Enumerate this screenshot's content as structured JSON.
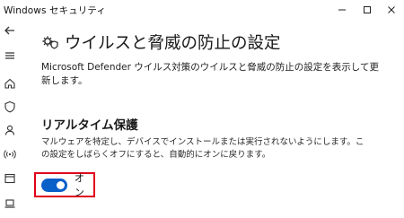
{
  "window": {
    "title": "Windows セキュリティ"
  },
  "rail": {
    "items": [
      "back",
      "menu",
      "home",
      "shield",
      "person",
      "wifi",
      "app-browser",
      "device"
    ]
  },
  "header": {
    "title": "ウイルスと脅威の防止の設定",
    "icon": "gear-shield-icon"
  },
  "description": "Microsoft Defender ウイルス対策のウイルスと脅威の防止の設定を表示して更新します。",
  "realtime": {
    "title": "リアルタイム保護",
    "description": "マルウェアを特定し、デバイスでインストールまたは実行されないようにします。この設定をしばらくオフにすると、自動的にオンに戻ります。",
    "toggle_state": "on",
    "toggle_label": "オン"
  },
  "colors": {
    "accent": "#0a5fc8",
    "highlight": "#e1001a"
  }
}
